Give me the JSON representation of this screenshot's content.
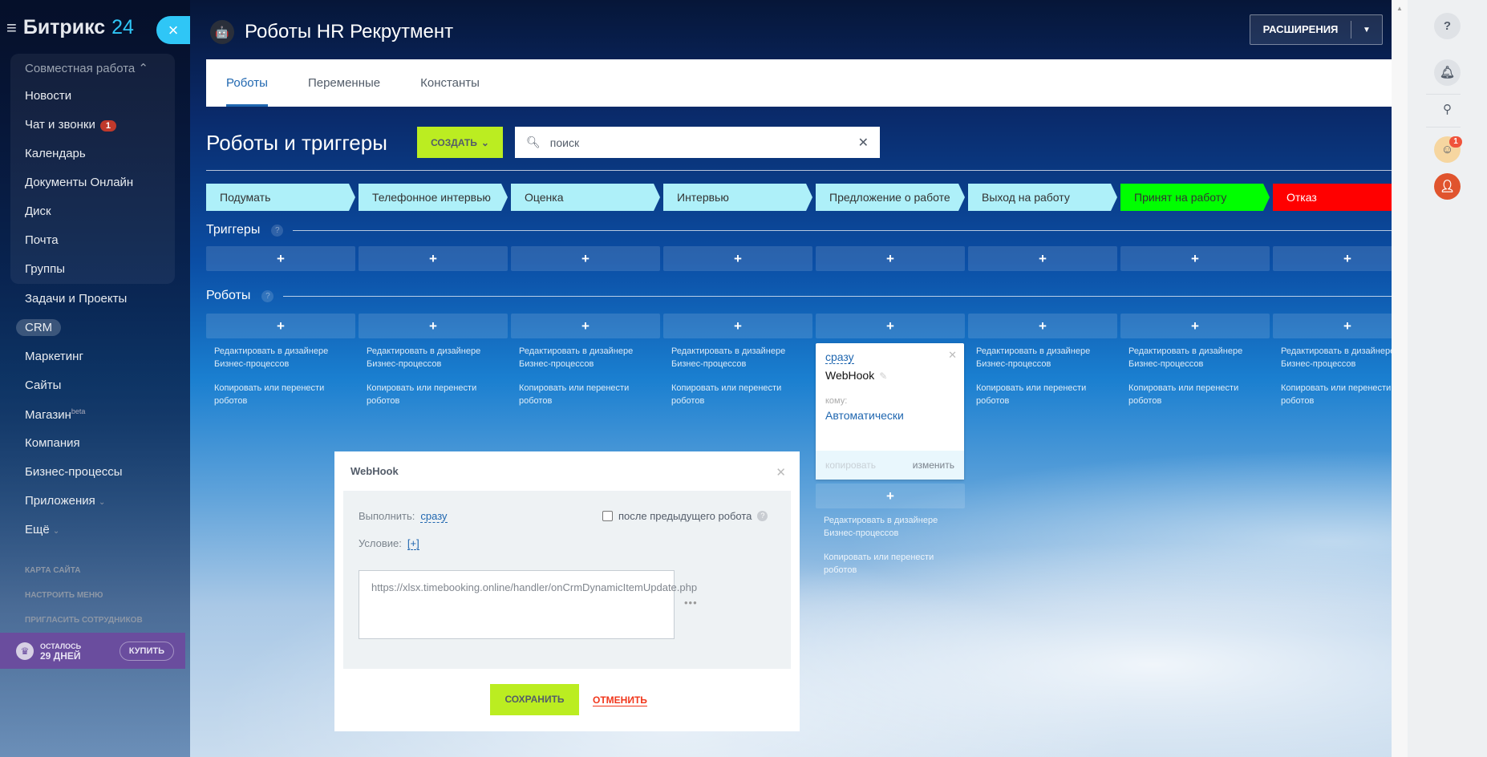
{
  "sidebar": {
    "logo": "Битрикс",
    "logo_num": "24",
    "group": "Совместная работа",
    "items": [
      {
        "label": "Новости"
      },
      {
        "label": "Чат и звонки",
        "badge": "1"
      },
      {
        "label": "Календарь"
      },
      {
        "label": "Документы Онлайн"
      },
      {
        "label": "Диск"
      },
      {
        "label": "Почта"
      },
      {
        "label": "Группы"
      }
    ],
    "items2": [
      {
        "label": "Задачи и Проекты"
      },
      {
        "label": "CRM"
      },
      {
        "label": "Маркетинг"
      },
      {
        "label": "Сайты"
      },
      {
        "label": "Магазин",
        "sup": "beta"
      },
      {
        "label": "Компания"
      },
      {
        "label": "Бизнес-процессы"
      },
      {
        "label": "Приложения"
      },
      {
        "label": "Ещё"
      }
    ],
    "small": [
      "КАРТА САЙТА",
      "НАСТРОИТЬ МЕНЮ",
      "ПРИГЛАСИТЬ СОТРУДНИКОВ"
    ],
    "trial": {
      "left": "ОСТАЛОСЬ",
      "days": "29 ДНЕЙ",
      "buy": "КУПИТЬ"
    }
  },
  "header": {
    "title": "Роботы HR Рекрутмент",
    "extensions": "РАСШИРЕНИЯ"
  },
  "tabs": [
    {
      "label": "Роботы",
      "active": true
    },
    {
      "label": "Переменные"
    },
    {
      "label": "Константы"
    }
  ],
  "section": {
    "title": "Роботы и триггеры",
    "create": "СОЗДАТЬ",
    "search_placeholder": "поиск"
  },
  "stages": [
    {
      "label": "Подумать",
      "color": "#aef0f9"
    },
    {
      "label": "Телефонное интервью",
      "color": "#aef0f9"
    },
    {
      "label": "Оценка",
      "color": "#aef0f9"
    },
    {
      "label": "Интервью",
      "color": "#aef0f9"
    },
    {
      "label": "Предложение о работе",
      "color": "#aef0f9"
    },
    {
      "label": "Выход на работу",
      "color": "#aef0f9"
    },
    {
      "label": "Принят на работу",
      "color": "#00ff00"
    },
    {
      "label": "Отказ",
      "color": "#ff0000"
    }
  ],
  "triggers_label": "Триггеры",
  "robots_label": "Роботы",
  "links": {
    "edit": "Редактировать в дизайнере Бизнес-процессов",
    "copy": "Копировать или перенести роботов"
  },
  "card": {
    "when": "сразу",
    "name": "WebHook",
    "to_label": "кому:",
    "to_value": "Автоматически",
    "copy": "копировать",
    "edit": "изменить"
  },
  "modal": {
    "title": "WebHook",
    "run_label": "Выполнить:",
    "run_value": "сразу",
    "after_prev": "после предыдущего робота",
    "condition_label": "Условие:",
    "condition_add": "[+]",
    "url": "https://xlsx.timebooking.online/handler/onCrmDynamicItemUpdate.php",
    "save": "СОХРАНИТЬ",
    "cancel": "ОТМЕНИТЬ"
  },
  "right": {
    "notif_count": "1"
  }
}
